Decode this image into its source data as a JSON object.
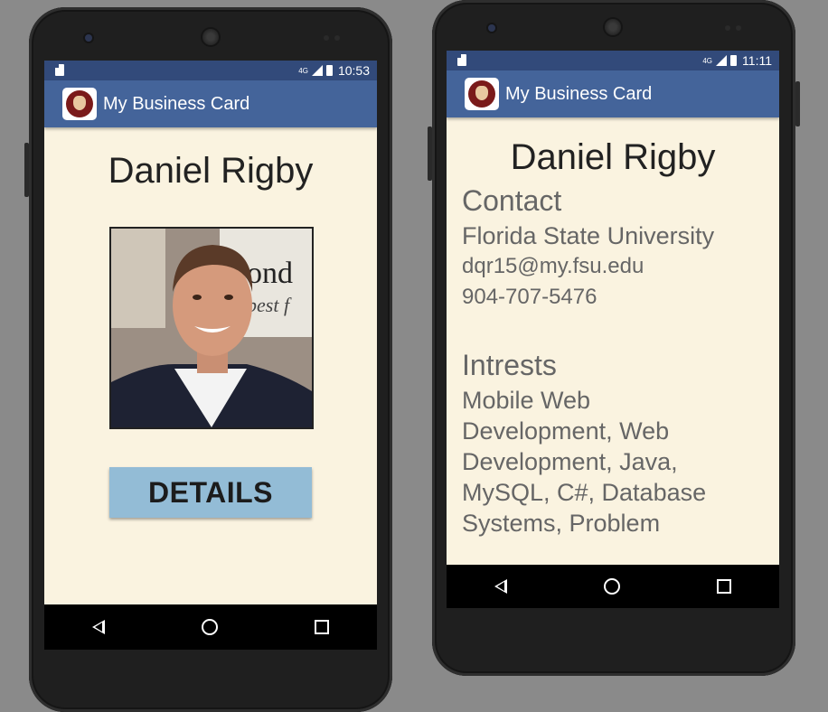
{
  "phone1": {
    "status": {
      "network": "4G",
      "time": "10:53"
    },
    "appbar": {
      "title": "My Business Card"
    },
    "name": "Daniel Rigby",
    "photo_alt": "Daniel Rigby",
    "details_button": "DETAILS"
  },
  "phone2": {
    "status": {
      "network": "4G",
      "time": "11:11"
    },
    "appbar": {
      "title": "My Business Card"
    },
    "name": "Daniel Rigby",
    "contact_heading": "Contact",
    "university": "Florida State University",
    "email": "dqr15@my.fsu.edu",
    "phone": "904-707-5476",
    "interests_heading": "Intrests",
    "interests_lines": [
      "Mobile Web",
      "Development, Web",
      "Development, Java,",
      "MySQL, C#, Database",
      "Systems, Problem"
    ]
  },
  "colors": {
    "statusbar": "#324a7a",
    "appbar": "#44649a",
    "content_bg": "#faf3e0",
    "button_bg": "#93bcd6"
  },
  "icons": [
    "sd-card-icon",
    "signal-icon",
    "battery-icon",
    "app-logo-icon",
    "back-icon",
    "home-icon",
    "recents-icon"
  ]
}
